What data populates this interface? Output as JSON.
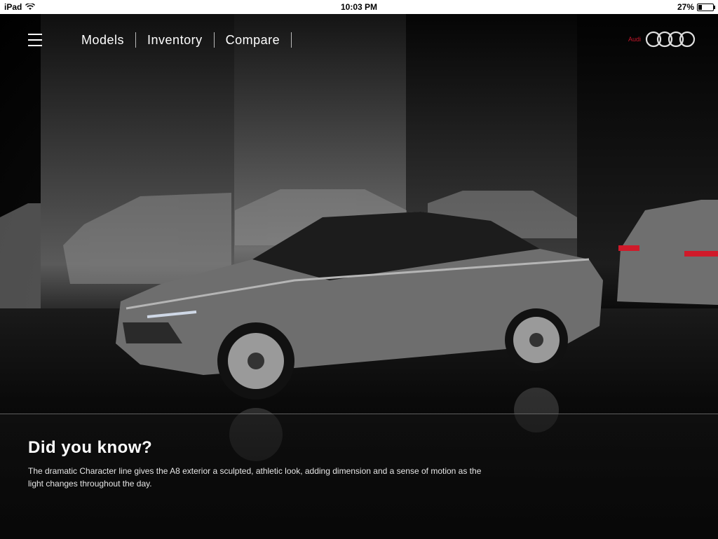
{
  "status_bar": {
    "device": "iPad",
    "time": "10:03 PM",
    "battery": "27%",
    "battery_level": 0.27
  },
  "nav": {
    "items": [
      {
        "label": "Models"
      },
      {
        "label": "Inventory"
      },
      {
        "label": "Compare"
      }
    ],
    "brand": "Audi"
  },
  "hero": {
    "heading": "Did you know?",
    "body": "The dramatic Character line gives the A8 exterior a sculpted, athletic look, adding dimension and a sense of motion as the light changes throughout the day."
  },
  "colors": {
    "brand_red": "#c4162a",
    "text": "#ffffff"
  }
}
